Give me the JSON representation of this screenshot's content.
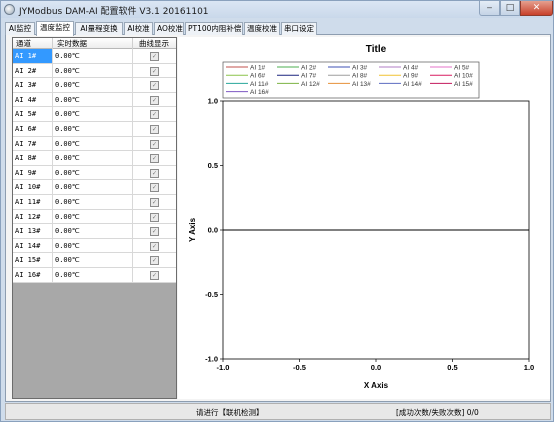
{
  "window": {
    "title": "JYModbus  DAM-AI 配置软件 V3.1   20161101",
    "minimize_symbol": "‒",
    "maximize_symbol": "□",
    "close_symbol": "✕"
  },
  "tabs": [
    {
      "label": "AI监控"
    },
    {
      "label": "温度监控",
      "active": true
    },
    {
      "label": "AI量程变换"
    },
    {
      "label": "AI校准"
    },
    {
      "label": "AO校准"
    },
    {
      "label": "PT100内阻补偿"
    },
    {
      "label": "温度校准"
    },
    {
      "label": "串口设定"
    }
  ],
  "table": {
    "headers": [
      "通道",
      "实时数据",
      "曲线显示"
    ],
    "rows": [
      {
        "channel": "AI 1#",
        "value": "0.00℃",
        "checked": true
      },
      {
        "channel": "AI 2#",
        "value": "0.00℃",
        "checked": true
      },
      {
        "channel": "AI 3#",
        "value": "0.00℃",
        "checked": true
      },
      {
        "channel": "AI 4#",
        "value": "0.00℃",
        "checked": true
      },
      {
        "channel": "AI 5#",
        "value": "0.00℃",
        "checked": true
      },
      {
        "channel": "AI 6#",
        "value": "0.00℃",
        "checked": true
      },
      {
        "channel": "AI 7#",
        "value": "0.00℃",
        "checked": true
      },
      {
        "channel": "AI 8#",
        "value": "0.00℃",
        "checked": true
      },
      {
        "channel": "AI 9#",
        "value": "0.00℃",
        "checked": true
      },
      {
        "channel": "AI 10#",
        "value": "0.00℃",
        "checked": true
      },
      {
        "channel": "AI 11#",
        "value": "0.00℃",
        "checked": true
      },
      {
        "channel": "AI 12#",
        "value": "0.00℃",
        "checked": true
      },
      {
        "channel": "AI 13#",
        "value": "0.00℃",
        "checked": true
      },
      {
        "channel": "AI 14#",
        "value": "0.00℃",
        "checked": true
      },
      {
        "channel": "AI 15#",
        "value": "0.00℃",
        "checked": true
      },
      {
        "channel": "AI 16#",
        "value": "0.00℃",
        "checked": true
      }
    ],
    "check_symbol": "✓"
  },
  "chart_data": {
    "type": "line",
    "title": "Title",
    "xlabel": "X Axis",
    "ylabel": "Y Axis",
    "xlim": [
      -1.0,
      1.0
    ],
    "ylim": [
      -1.0,
      1.0
    ],
    "xticks": [
      "-1.0",
      "-0.5",
      "0.0",
      "0.5",
      "1.0"
    ],
    "yticks": [
      "1.0",
      "0.5",
      "0.0",
      "-0.5",
      "-1.0"
    ],
    "legend_placement": "top",
    "series": [
      {
        "name": "AI 1#",
        "color": "#c0504d"
      },
      {
        "name": "AI 2#",
        "color": "#4caf50"
      },
      {
        "name": "AI 3#",
        "color": "#3f51b5"
      },
      {
        "name": "AI 4#",
        "color": "#b07cc6"
      },
      {
        "name": "AI 5#",
        "color": "#e573c8"
      },
      {
        "name": "AI 6#",
        "color": "#8bc34a"
      },
      {
        "name": "AI 7#",
        "color": "#1a237e"
      },
      {
        "name": "AI 8#",
        "color": "#9e9e9e"
      },
      {
        "name": "AI 9#",
        "color": "#f1c232"
      },
      {
        "name": "AI 10#",
        "color": "#d81b60"
      },
      {
        "name": "AI 11#",
        "color": "#26a69a"
      },
      {
        "name": "AI 12#",
        "color": "#7cb342"
      },
      {
        "name": "AI 13#",
        "color": "#e69138"
      },
      {
        "name": "AI 14#",
        "color": "#5c6bc0"
      },
      {
        "name": "AI 15#",
        "color": "#c2185b"
      },
      {
        "name": "AI 16#",
        "color": "#7e57c2"
      }
    ],
    "zero_line": 0.0
  },
  "status": {
    "left": "请进行【联机检测】",
    "right": "[成功次数/失败次数] 0/0"
  }
}
